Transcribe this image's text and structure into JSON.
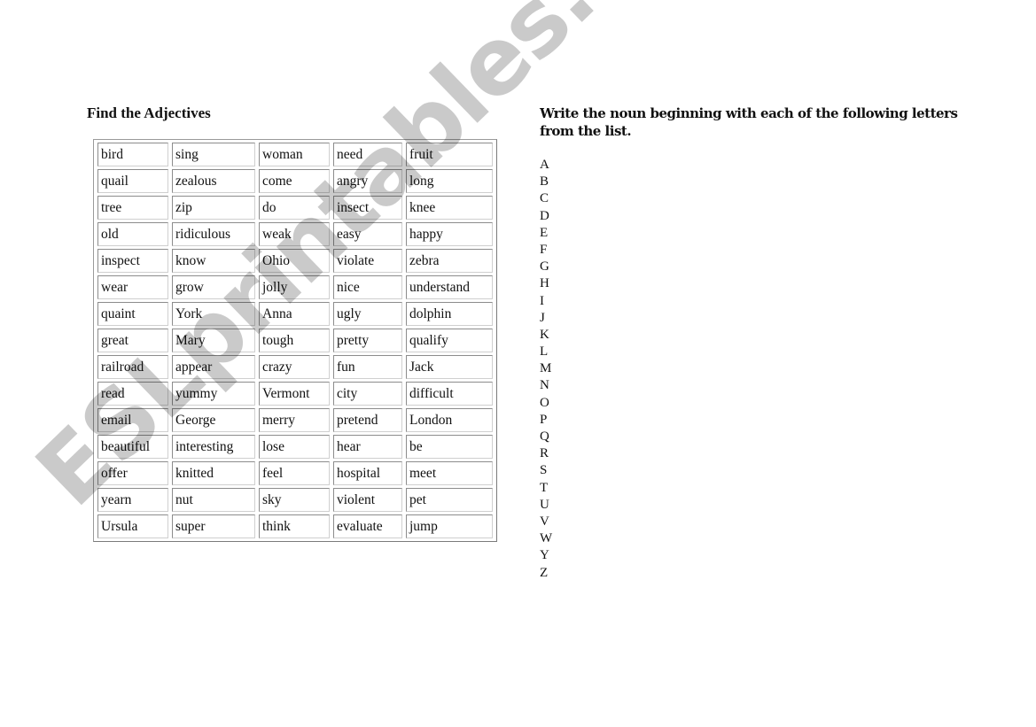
{
  "left_section": {
    "title": "Find the Adjectives",
    "table": {
      "rows": [
        [
          "bird",
          "sing",
          "woman",
          "need",
          "fruit"
        ],
        [
          "quail",
          "zealous",
          "come",
          "angry",
          "long"
        ],
        [
          "tree",
          "zip",
          "do",
          "insect",
          "knee"
        ],
        [
          "old",
          "ridiculous",
          "weak",
          "easy",
          "happy"
        ],
        [
          "inspect",
          "know",
          "Ohio",
          "violate",
          "zebra"
        ],
        [
          "wear",
          "grow",
          "jolly",
          "nice",
          "understand"
        ],
        [
          "quaint",
          "York",
          "Anna",
          "ugly",
          "dolphin"
        ],
        [
          "great",
          "Mary",
          "tough",
          "pretty",
          "qualify"
        ],
        [
          "railroad",
          "appear",
          "crazy",
          "fun",
          "Jack"
        ],
        [
          "read",
          "yummy",
          "Vermont",
          "city",
          "difficult"
        ],
        [
          "email",
          "George",
          "merry",
          "pretend",
          "London"
        ],
        [
          "beautiful",
          "interesting",
          "lose",
          "hear",
          "be"
        ],
        [
          "offer",
          "knitted",
          "feel",
          "hospital",
          "meet"
        ],
        [
          "yearn",
          "nut",
          "sky",
          "violent",
          "pet"
        ],
        [
          "Ursula",
          "super",
          "think",
          "evaluate",
          "jump"
        ]
      ]
    }
  },
  "right_section": {
    "instructions": "Write the noun beginning with each of the following letters from the list.",
    "letters": [
      "A",
      "B",
      "C",
      "D",
      "E",
      "F",
      "G",
      "H",
      "I",
      "J",
      "K",
      "L",
      "M",
      "N",
      "O",
      "P",
      "Q",
      "R",
      "S",
      "T",
      "U",
      "V",
      "W",
      "Y",
      "Z"
    ]
  },
  "watermark": {
    "text": "ESLprintables.com",
    "color": "#c6c6c6"
  }
}
